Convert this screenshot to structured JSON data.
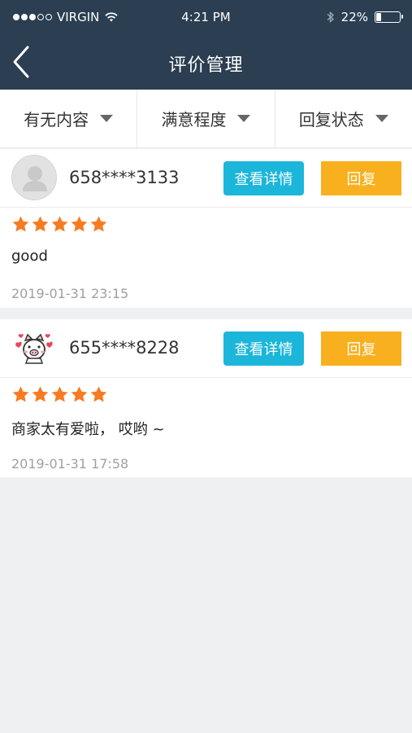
{
  "status_bar": {
    "carrier": "VIRGIN",
    "time": "4:21 PM",
    "battery": "22%",
    "battery_level": 0.22
  },
  "nav": {
    "title": "评价管理"
  },
  "filters": [
    {
      "label": "有无内容"
    },
    {
      "label": "满意程度"
    },
    {
      "label": "回复状态"
    }
  ],
  "reviews": [
    {
      "user": "658****3133",
      "rating": 5,
      "comment": "good",
      "time": "2019-01-31 23:15",
      "detail_label": "查看详情",
      "reply_label": "回复"
    },
    {
      "user": "655****8228",
      "rating": 5,
      "comment": "商家太有爱啦， 哎哟 ~",
      "time": "2019-01-31 17:58",
      "detail_label": "查看详情",
      "reply_label": "回复"
    }
  ],
  "colors": {
    "header": "#2b3e52",
    "detail_button": "#1bb6d9",
    "reply_button": "#f8b01e",
    "star": "#f77b21"
  }
}
